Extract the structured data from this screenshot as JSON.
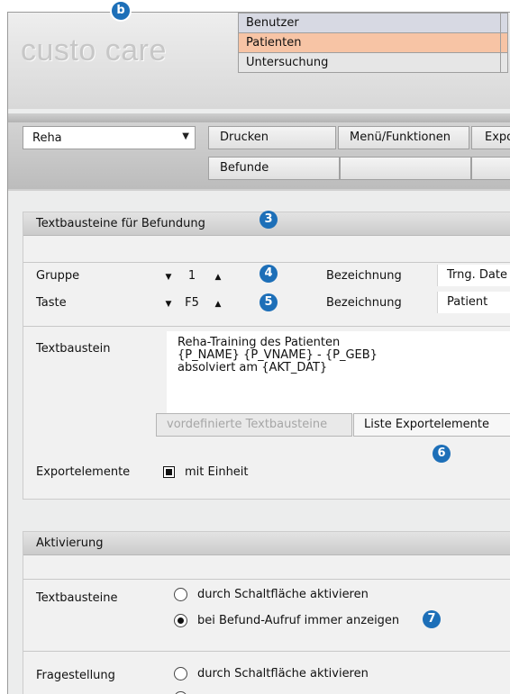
{
  "app": {
    "logo": "custo care"
  },
  "module_tabs": [
    "Benutzer",
    "Patienten",
    "Untersuchung"
  ],
  "toolbar": {
    "combo_value": "Reha",
    "buttons": [
      "Drucken",
      "Menü/Funktionen",
      "Expo"
    ],
    "sub_buttons": [
      "Befunde"
    ]
  },
  "section1": {
    "title": "Textbausteine für Befundung",
    "gruppe_label": "Gruppe",
    "gruppe_value": "1",
    "taste_label": "Taste",
    "taste_value": "F5",
    "bezeichnung_label": "Bezeichnung",
    "bezeichnung_gruppe": "Trng. Date",
    "bezeichnung_taste": "Patient",
    "textbaustein_label": "Textbaustein",
    "textbaustein_value": "Reha-Training des Patienten\n{P_NAME} {P_VNAME} - {P_GEB}\nabsolviert am {AKT_DAT}",
    "btn_predefined": "vordefinierte Textbausteine",
    "btn_export_list": "Liste Exportelemente",
    "exportelemente_label": "Exportelemente",
    "mit_einheit_label": "mit Einheit",
    "mit_einheit_checked": true
  },
  "section2": {
    "title": "Aktivierung",
    "textbausteine_label": "Textbausteine",
    "opt_button": "durch Schaltfläche aktivieren",
    "opt_always": "bei Befund-Aufruf immer anzeigen",
    "fragestellung_label": "Fragestellung",
    "frag_opt_button": "durch Schaltfläche aktivieren"
  },
  "callouts": {
    "b": "b",
    "c3": "3",
    "c4": "4",
    "c5": "5",
    "c6": "6",
    "c7": "7"
  },
  "colors": {
    "callout": "#1d6fb8",
    "tab_benutzer": "#d7d9e3",
    "tab_patienten": "#f7c4a5",
    "tab_untersuchung": "#e6e6e6"
  }
}
